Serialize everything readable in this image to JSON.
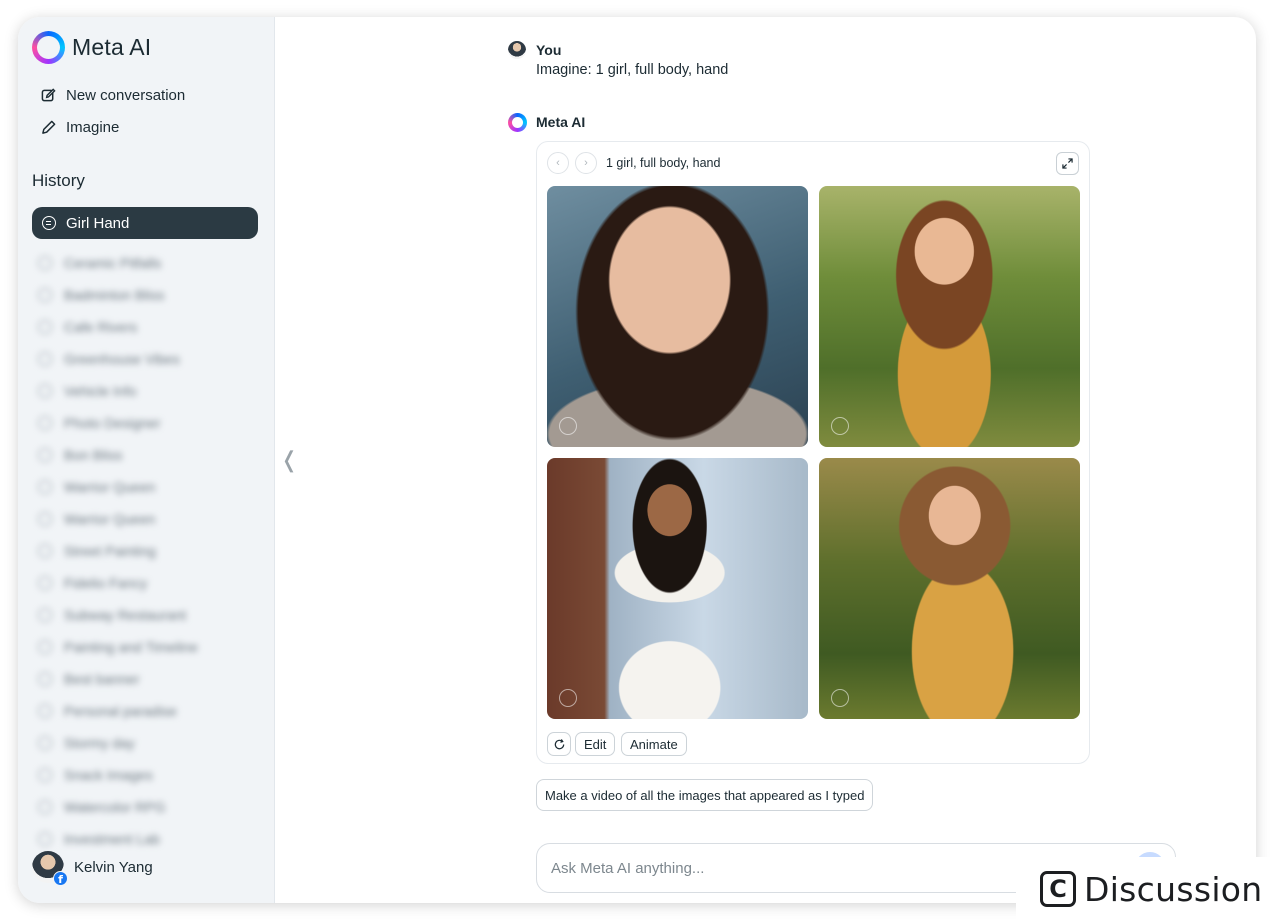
{
  "app": {
    "name": "Meta AI"
  },
  "sidebar": {
    "new_conversation": "New conversation",
    "imagine": "Imagine",
    "history_title": "History",
    "active_item": "Girl Hand",
    "blurred_items": [
      "Ceramic Pitfalls",
      "Badminton Bliss",
      "Cafe Rivers",
      "Greenhouse Vibes",
      "Vehicle Info",
      "Photo Designer",
      "Bon Bliss",
      "Warrior Queen",
      "Warrior Queen",
      "Street Painting",
      "Fidelio Fancy",
      "Subway Restaurant",
      "Painting and Timeline",
      "Best banner",
      "Personal paradise",
      "Stormy day",
      "Snack Images",
      "Watercolor RPG",
      "Investment Lab"
    ]
  },
  "user": {
    "name": "Kelvin Yang",
    "badge": "f"
  },
  "conversation": {
    "user_label": "You",
    "user_message": "Imagine: 1 girl, full body, hand",
    "ai_label": "Meta AI",
    "card_title": "1 girl, full body, hand",
    "prev_icon": "‹",
    "next_icon": "›",
    "edit_label": "Edit",
    "animate_label": "Animate",
    "suggestion": "Make a video of all the images that appeared as I typed"
  },
  "composer": {
    "placeholder": "Ask Meta AI anything..."
  },
  "collapse_icon": "❬",
  "watermark": {
    "icon": "C",
    "text": "Discussion"
  },
  "colors": {
    "accent": "#0866ff",
    "sidebar_bg": "#f1f4f7",
    "active_item_bg": "#2b3a43"
  }
}
